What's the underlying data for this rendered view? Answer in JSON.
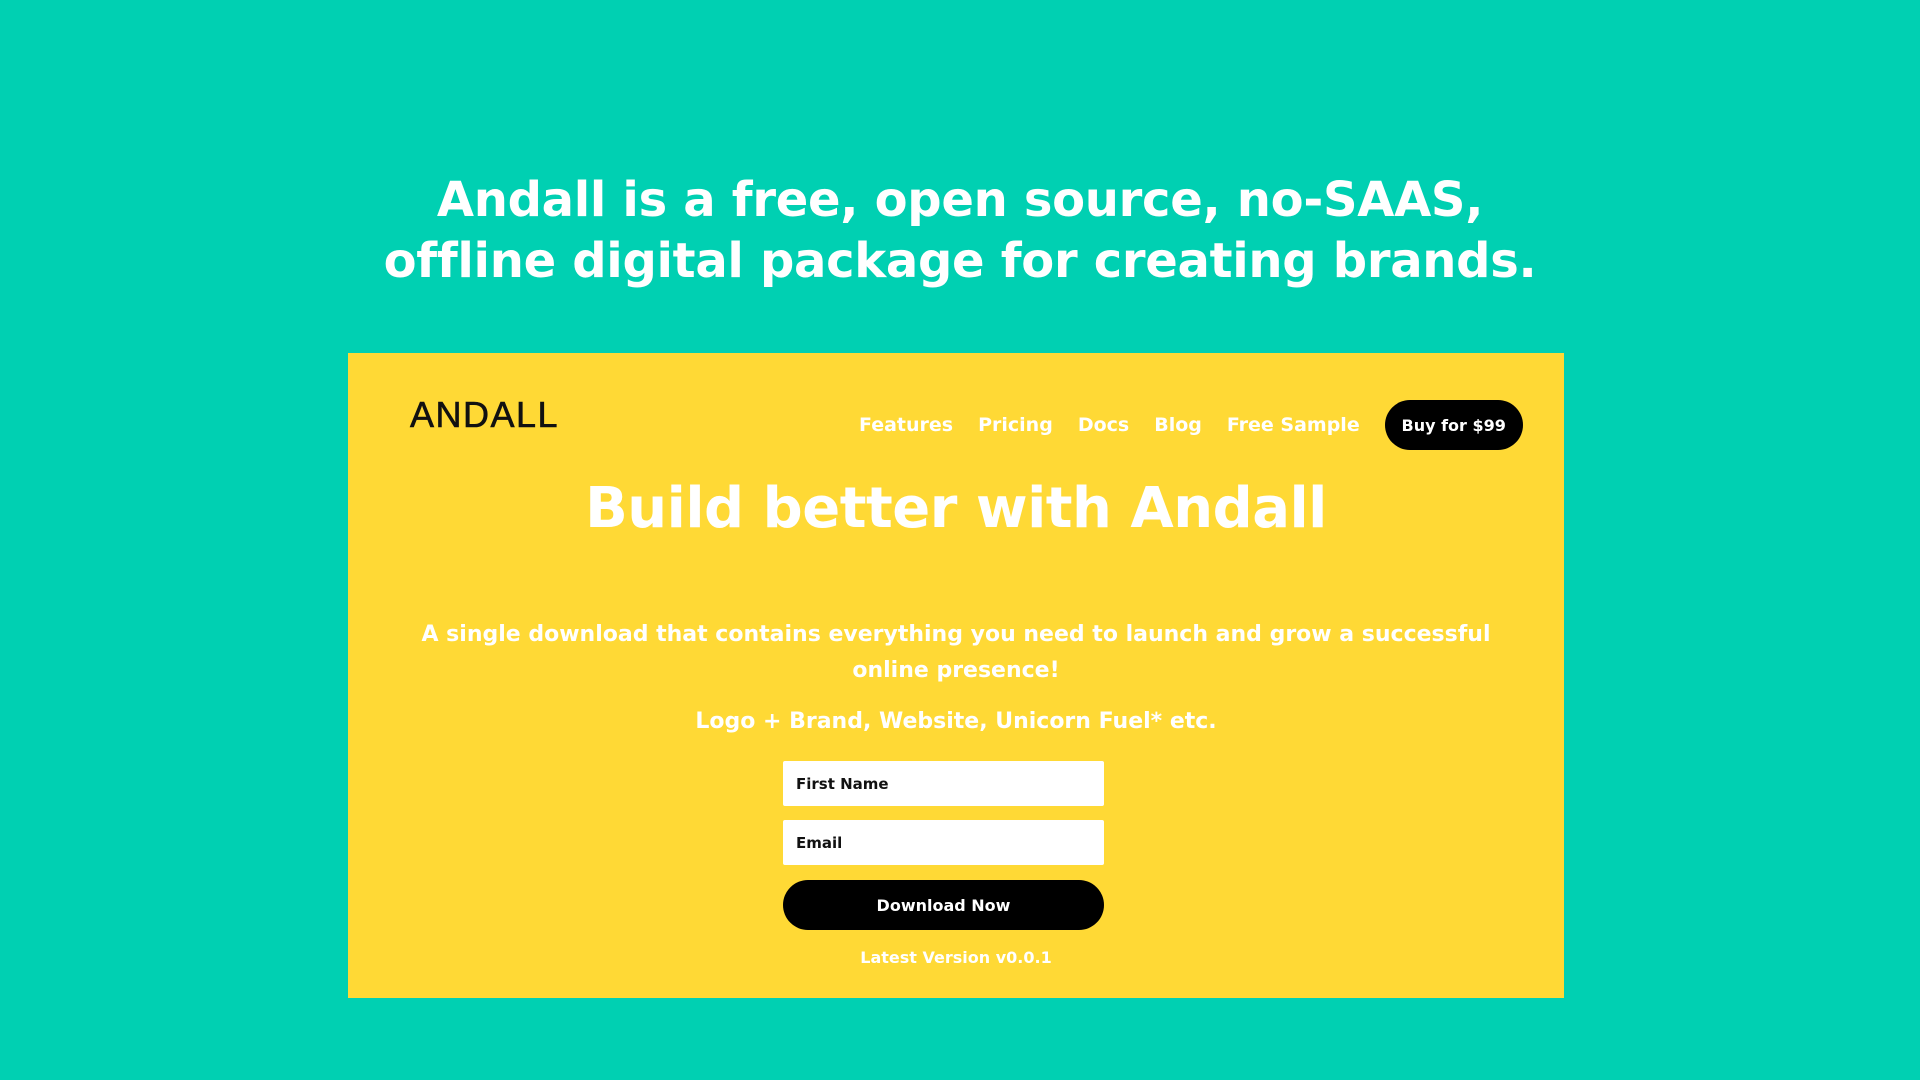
{
  "headline": {
    "line1": "Andall is a free, open source, no-SAAS,",
    "line2": "offline digital package for creating brands."
  },
  "site": {
    "logo": "ANDALL",
    "nav": {
      "items": [
        {
          "label": "Features"
        },
        {
          "label": "Pricing"
        },
        {
          "label": "Docs"
        },
        {
          "label": "Blog"
        },
        {
          "label": "Free Sample"
        }
      ],
      "buy_label": "Buy for $99"
    },
    "hero": {
      "title": "Build better with Andall",
      "subtitle": "A single download that contains everything you need to launch and grow a successful online presence!",
      "features": "Logo + Brand, Website, Unicorn Fuel* etc."
    },
    "form": {
      "first_name_placeholder": "First Name",
      "email_placeholder": "Email",
      "submit_label": "Download Now"
    },
    "version": "Latest Version v0.0.1"
  },
  "colors": {
    "page_background": "#00d0b2",
    "panel_background": "#ffd935",
    "button_background": "#000000",
    "text": "#ffffff"
  }
}
